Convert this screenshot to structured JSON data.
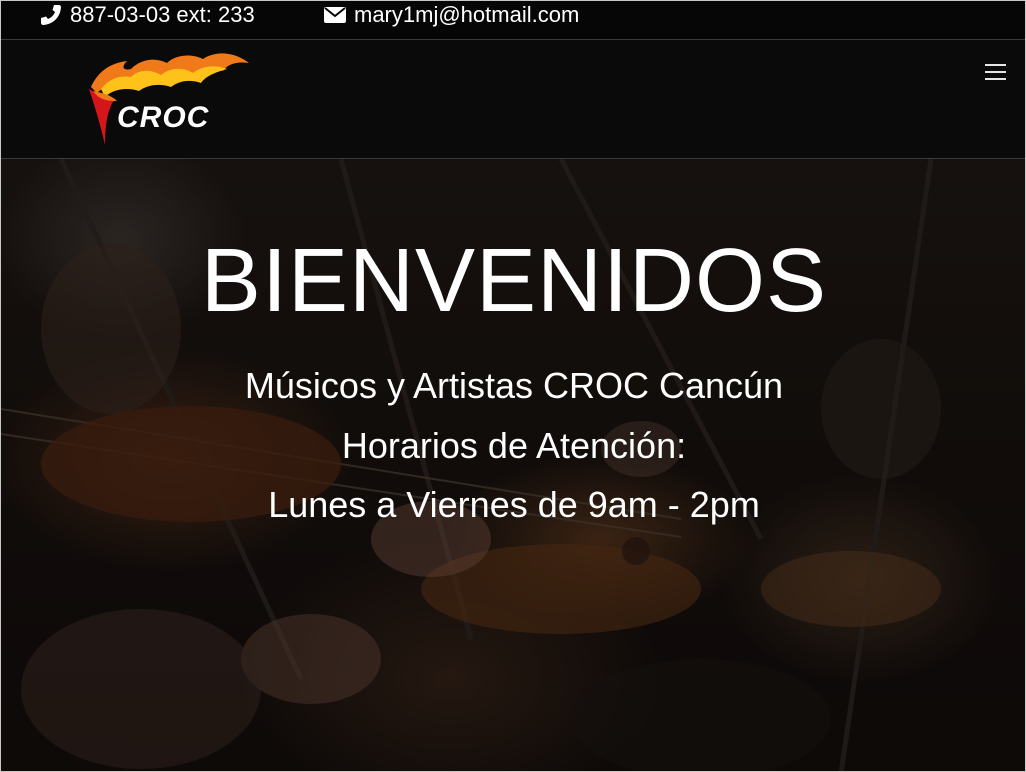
{
  "topbar": {
    "phone": "887-03-03 ext: 233",
    "email": "mary1mj@hotmail.com",
    "phone_icon": "phone-icon",
    "email_icon": "envelope-icon"
  },
  "header": {
    "logo_text": "CROC",
    "menu_icon": "hamburger-menu-icon"
  },
  "hero": {
    "title": "BIENVENIDOS",
    "line1": "Músicos y Artistas CROC Cancún",
    "line2": "Horarios de Atención:",
    "line3": "Lunes a Viernes de 9am - 2pm"
  },
  "colors": {
    "background": "#0a0a0a",
    "text": "#ffffff",
    "flame_orange": "#f07a1a",
    "flame_red": "#d4161b",
    "border": "#3a3a3a"
  }
}
